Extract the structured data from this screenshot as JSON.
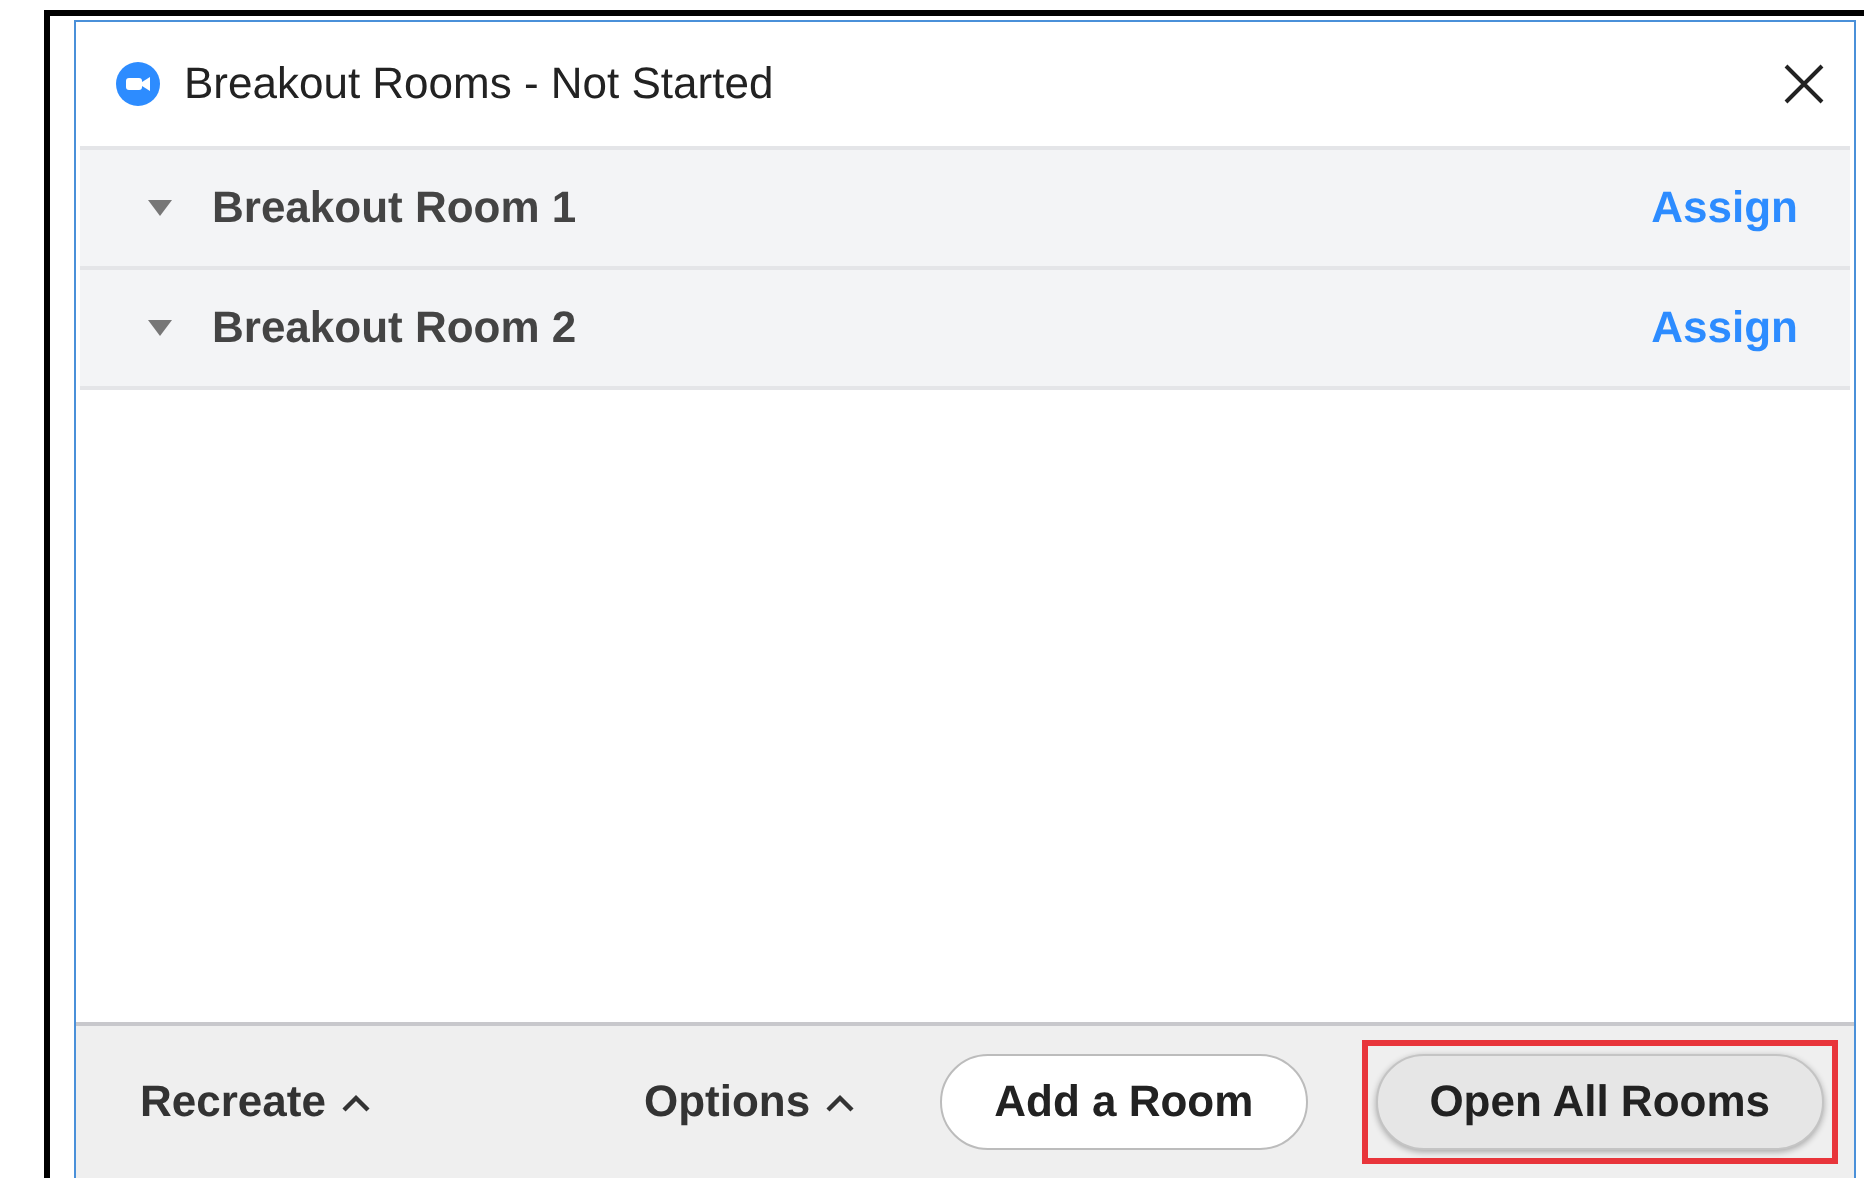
{
  "window": {
    "title": "Breakout Rooms - Not Started"
  },
  "rooms": [
    {
      "name": "Breakout Room 1",
      "expanded": true,
      "action": "Assign"
    },
    {
      "name": "Breakout Room 2",
      "expanded": true,
      "action": "Assign"
    }
  ],
  "footer": {
    "recreate": "Recreate",
    "options": "Options",
    "buttons": [
      {
        "label": "Add a Room",
        "kind": "outline",
        "highlighted": false
      },
      {
        "label": "Open All Rooms",
        "kind": "filled",
        "highlighted": true
      }
    ]
  }
}
